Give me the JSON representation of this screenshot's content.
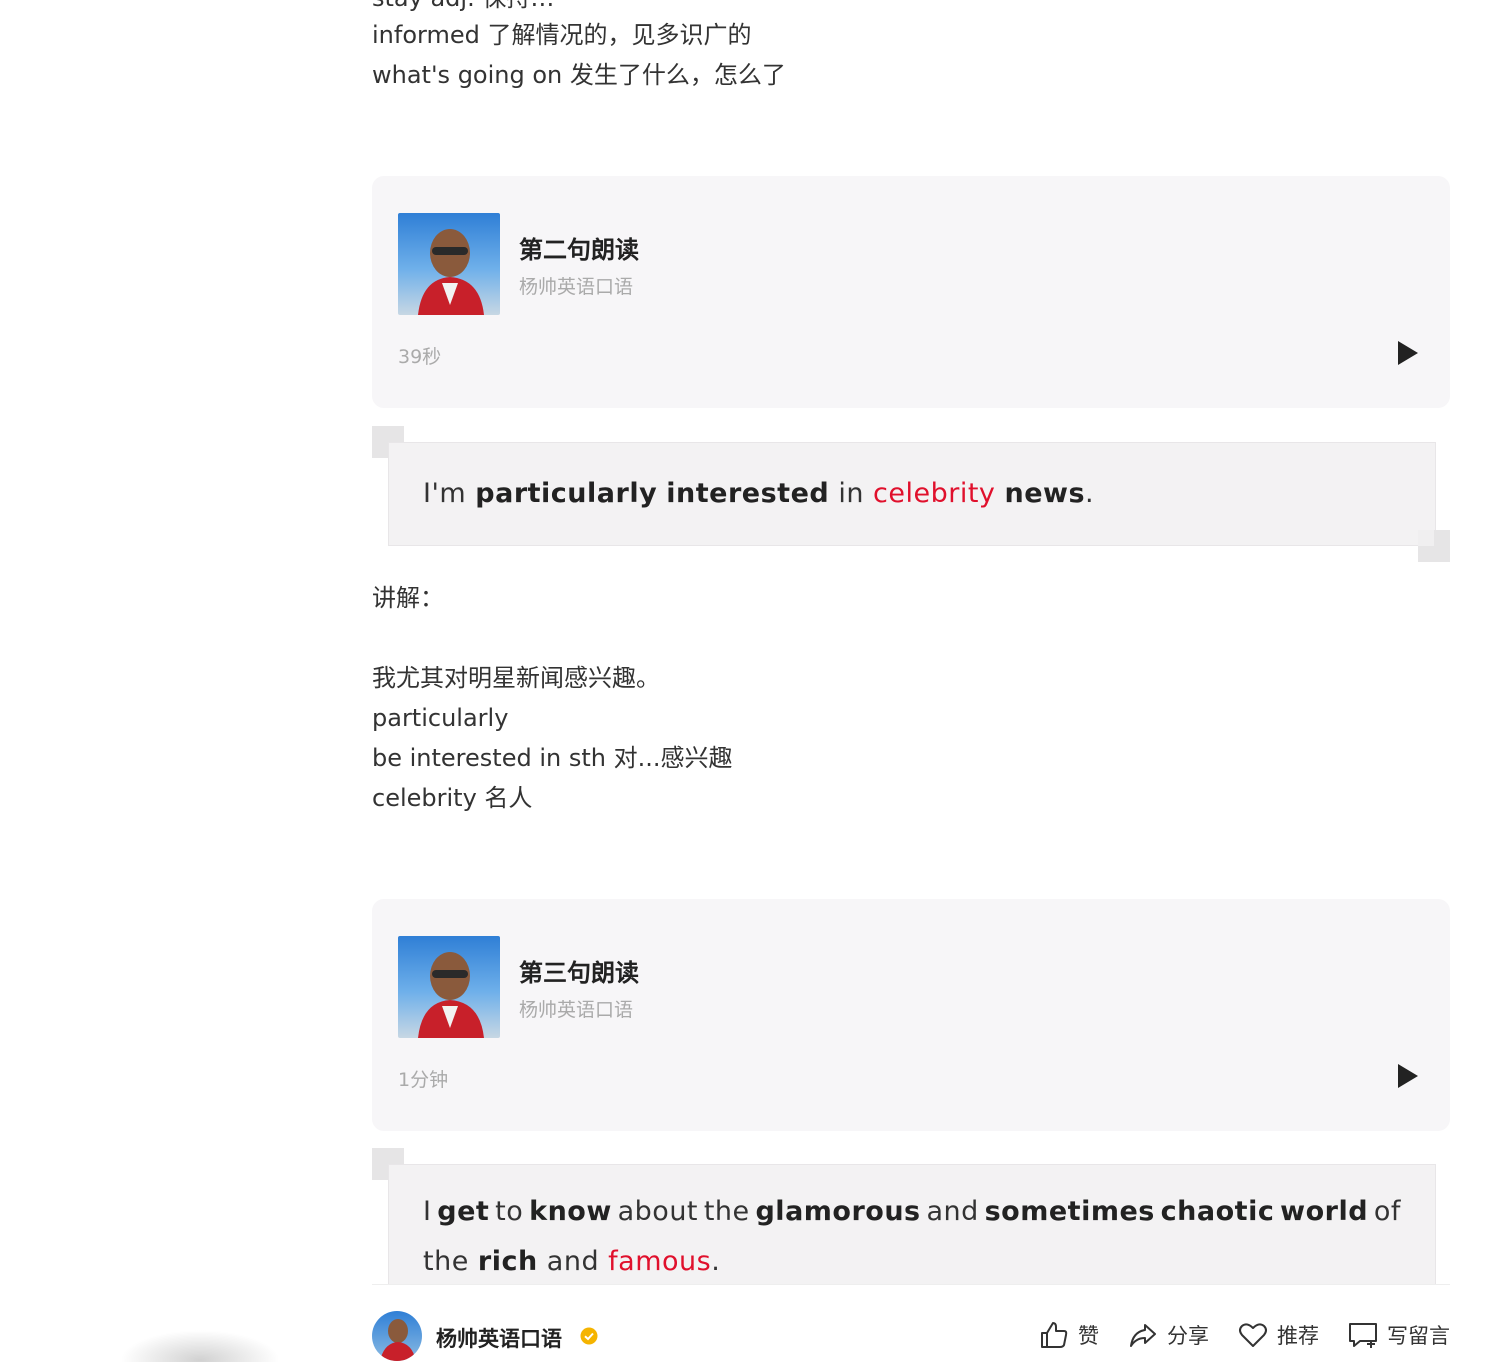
{
  "article": {
    "top_cut_line": "stay adj. 保持…",
    "top_lines": [
      "informed 了解情况的，见多识广的",
      "what's going on 发生了什么，怎么了"
    ]
  },
  "audio_cards": [
    {
      "title": "第二句朗读",
      "author": "杨帅英语口语",
      "duration": "39秒"
    },
    {
      "title": "第三句朗读",
      "author": "杨帅英语口语",
      "duration": "1分钟"
    }
  ],
  "quote1": {
    "segments": [
      {
        "t": "I'm ",
        "s": "normal"
      },
      {
        "t": "particularly",
        "s": "bold"
      },
      {
        "t": " ",
        "s": "normal"
      },
      {
        "t": "interested",
        "s": "bold"
      },
      {
        "t": " in ",
        "s": "normal"
      },
      {
        "t": "celebrity",
        "s": "red"
      },
      {
        "t": " ",
        "s": "normal"
      },
      {
        "t": "news",
        "s": "bold"
      },
      {
        "t": ".",
        "s": "normal"
      }
    ]
  },
  "explain": {
    "heading": "讲解：",
    "lines": [
      "我尤其对明星新闻感兴趣。",
      "particularly",
      "be interested in sth 对...感兴趣",
      "celebrity 名人"
    ]
  },
  "quote2": {
    "segments_line1": [
      {
        "t": "I ",
        "s": "normal"
      },
      {
        "t": "get",
        "s": "bold"
      },
      {
        "t": " to ",
        "s": "normal"
      },
      {
        "t": "know",
        "s": "bold"
      },
      {
        "t": " about the ",
        "s": "normal"
      },
      {
        "t": "glamorous",
        "s": "bold"
      },
      {
        "t": " and ",
        "s": "normal"
      },
      {
        "t": "sometimes chaotic world",
        "s": "bold"
      },
      {
        "t": " of",
        "s": "normal"
      }
    ],
    "segments_line2": [
      {
        "t": "the ",
        "s": "normal"
      },
      {
        "t": "rich",
        "s": "bold"
      },
      {
        "t": " and ",
        "s": "normal"
      },
      {
        "t": "famous",
        "s": "red"
      },
      {
        "t": ".",
        "s": "normal"
      }
    ]
  },
  "bottom_bar": {
    "account_name": "杨帅英语口语",
    "actions": {
      "like": "赞",
      "share": "分享",
      "recommend": "推荐",
      "comment": "写留言"
    }
  },
  "colors": {
    "accent_red": "#e0102c",
    "verified": "#f5b400"
  }
}
